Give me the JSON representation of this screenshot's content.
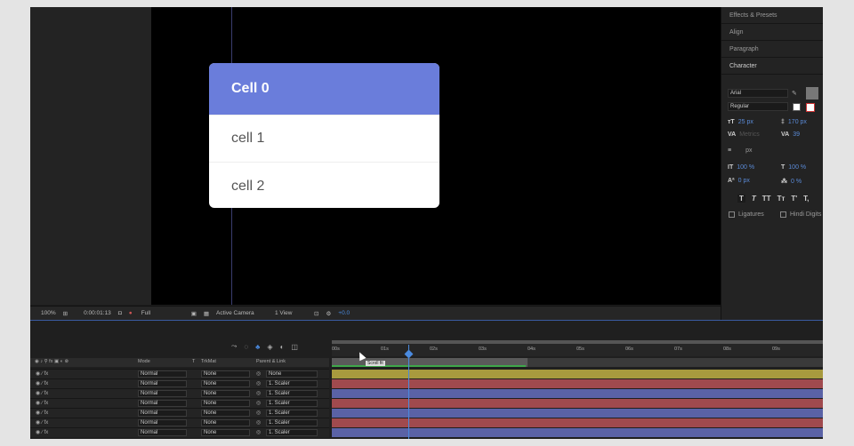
{
  "comp": {
    "cells": [
      "Cell 0",
      "cell 1",
      "cell 2"
    ],
    "colors": {
      "selected_cell": "#6a7ddb",
      "card": "#ffffff"
    }
  },
  "panels": [
    "Effects & Presets",
    "Align",
    "Paragraph",
    "Character"
  ],
  "character": {
    "font": "Arial",
    "style": "Regular",
    "size": "25 px",
    "leading": "170 px",
    "kerning": "Metrics",
    "tracking": "39",
    "stroke_width_unit": "px",
    "vscale": "100 %",
    "hscale": "100 %",
    "baseline": "0 px",
    "tsume": "0 %",
    "glyph_buttons": [
      "T",
      "T",
      "TT",
      "Tт",
      "T'",
      "T,"
    ],
    "ligatures": "Ligatures",
    "hindi_digits": "Hindi Digits"
  },
  "viewer_toolbar": {
    "zoom": "100%",
    "timecode": "0:00:01:13",
    "resolution": "Full",
    "camera": "Active Camera",
    "views": "1 View",
    "exposure": "+0.0"
  },
  "timeline": {
    "columns": {
      "mode": "Mode",
      "t": "T",
      "trkmat": "TrkMat",
      "parent": "Parent & Link"
    },
    "ruler_ticks": [
      "00s",
      "01s",
      "02s",
      "03s",
      "04s",
      "05s",
      "06s",
      "07s",
      "08s",
      "09s"
    ],
    "tooltip": "Scroll fit",
    "layers": [
      {
        "mode": "Normal",
        "trkmat": "None",
        "parent": "None",
        "color": "#a89a3e"
      },
      {
        "mode": "Normal",
        "trkmat": "None",
        "parent": "1. Scaler",
        "color": "#a04a4e"
      },
      {
        "mode": "Normal",
        "trkmat": "None",
        "parent": "1. Scaler",
        "color": "#5a62a6"
      },
      {
        "mode": "Normal",
        "trkmat": "None",
        "parent": "1. Scaler",
        "color": "#a04a4e"
      },
      {
        "mode": "Normal",
        "trkmat": "None",
        "parent": "1. Scaler",
        "color": "#5a62a6"
      },
      {
        "mode": "Normal",
        "trkmat": "None",
        "parent": "1. Scaler",
        "color": "#a04a4e"
      },
      {
        "mode": "Normal",
        "trkmat": "None",
        "parent": "1. Scaler",
        "color": "#5a62a6"
      }
    ]
  }
}
